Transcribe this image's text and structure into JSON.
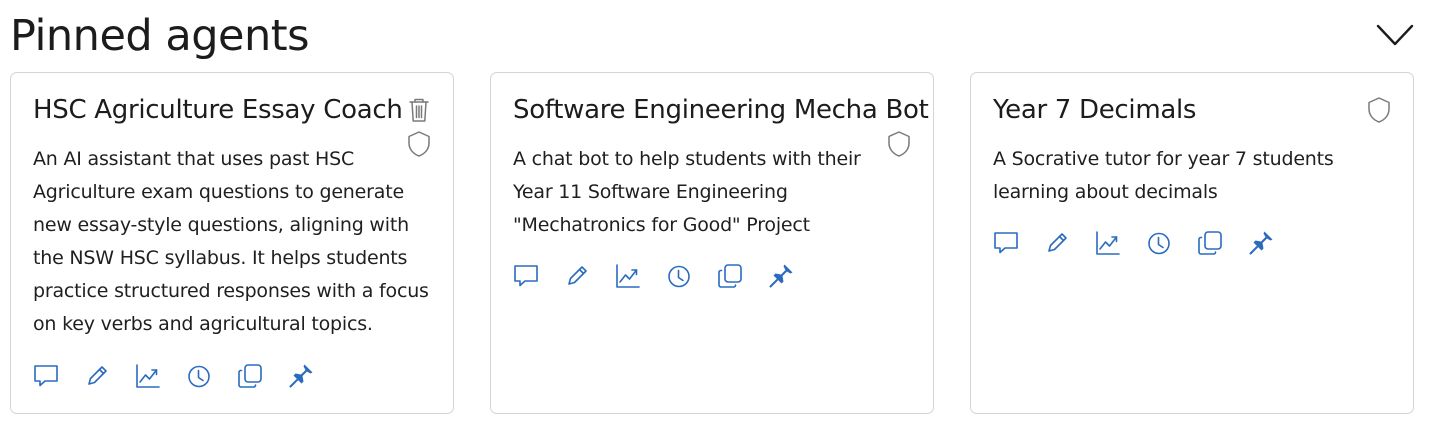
{
  "section": {
    "title": "Pinned agents",
    "collapse_icon": "chevron-down-icon"
  },
  "cards": [
    {
      "title": "HSC Agriculture Essay Coach",
      "description": "An AI assistant that uses past HSC Agriculture exam questions to generate new essay-style questions, aligning with the NSW HSC syllabus. It helps students practice structured responses with a focus on key verbs and agricultural topics.",
      "has_delete": true
    },
    {
      "title": "Software Engineering Mecha Bot",
      "description": "A chat bot to help students with their Year 11 Software Engineering \"Mechatronics for Good\" Project",
      "has_delete": false
    },
    {
      "title": "Year 7 Decimals",
      "description": "A Socrative tutor for year 7 students learning about decimals",
      "has_delete": false
    }
  ],
  "action_icons": [
    "chat-icon",
    "edit-icon",
    "analytics-icon",
    "history-icon",
    "duplicate-icon",
    "pin-icon"
  ],
  "colors": {
    "accent": "#2a6bc0",
    "muted_icon": "#7a7a7a",
    "card_border": "#d4d4d4"
  }
}
